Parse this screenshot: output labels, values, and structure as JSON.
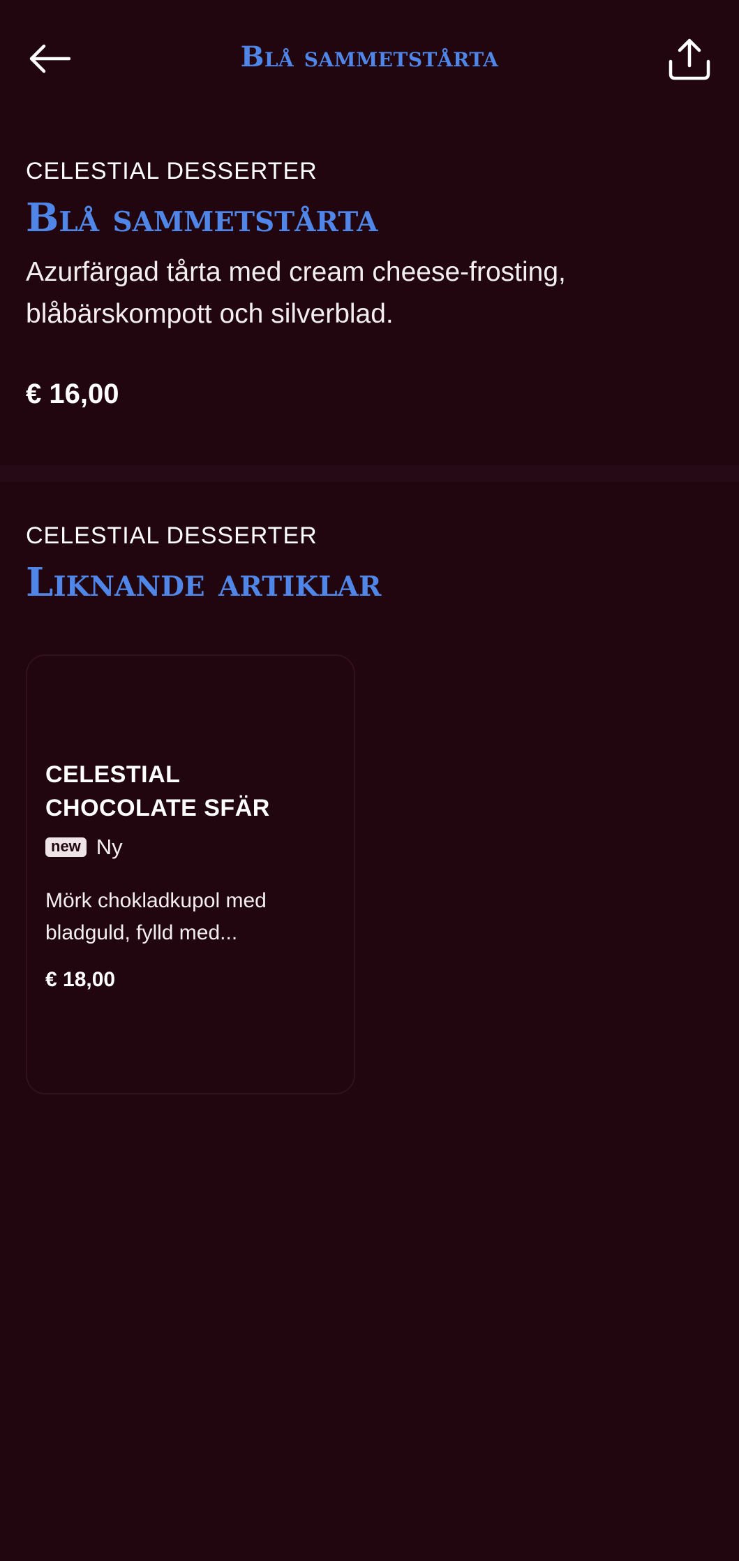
{
  "header": {
    "title": "Blå sammetstårta",
    "back_icon": "arrow-left-icon",
    "share_icon": "share-icon"
  },
  "product": {
    "category": "CELESTIAL DESSERTER",
    "title": "Blå sammetstårta",
    "description": "Azurfärgad tårta med cream cheese-frosting, blåbärskompott och silverblad.",
    "price": "€ 16,00"
  },
  "similar": {
    "category": "CELESTIAL DESSERTER",
    "title": "Liknande artiklar",
    "items": [
      {
        "name": "CELESTIAL CHOCOLATE SFÄR",
        "badge": "new",
        "badge_label": "Ny",
        "description": "Mörk chokladkupol med bladguld, fylld med...",
        "price": "€ 18,00"
      }
    ]
  },
  "colors": {
    "background": "#21060f",
    "accent": "#4f86e8",
    "text": "#ffffff",
    "divider": "#260b17"
  }
}
